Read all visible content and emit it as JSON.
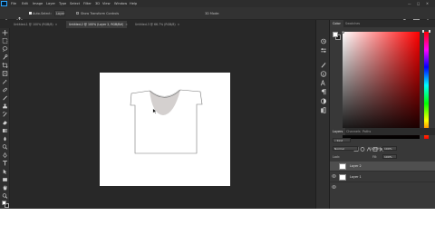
{
  "app": {
    "name": "Photoshop",
    "logo_text": "Ps"
  },
  "menu": [
    "File",
    "Edit",
    "Image",
    "Layer",
    "Type",
    "Select",
    "Filter",
    "3D",
    "View",
    "Window",
    "Help"
  ],
  "options_bar": {
    "auto_select_label": "Auto-Select:",
    "auto_select_value": "Layer",
    "show_transform_label": "Show Transform Controls",
    "mode_label": "3D Mode:"
  },
  "tabs": [
    {
      "label": "Untitled-1 @ 100% (RGB/8)",
      "active": false
    },
    {
      "label": "Untitled-2 @ 100% (Layer 2, RGB/8#)",
      "active": true
    },
    {
      "label": "Untitled-3 @ 66.7% (RGB/8)",
      "active": false
    }
  ],
  "color_panel": {
    "tabs": [
      "Color",
      "Swatches"
    ],
    "foreground": "#ffffff",
    "background": "#1a1a1a"
  },
  "layers_panel": {
    "tabs": [
      "Layers",
      "Channels",
      "Paths"
    ],
    "kind_label": "Kind",
    "blend_mode": "Normal",
    "opacity_label": "Opacity:",
    "opacity_value": "100%",
    "lock_label": "Lock:",
    "fill_label": "Fill:",
    "fill_value": "100%",
    "layers": [
      {
        "name": "Layer 2",
        "selected": true
      },
      {
        "name": "Layer 1",
        "selected": false
      }
    ]
  },
  "colors": {
    "canvas_bg": "#282828",
    "ui_bg": "#383838",
    "selection": "#4f4f4f"
  }
}
